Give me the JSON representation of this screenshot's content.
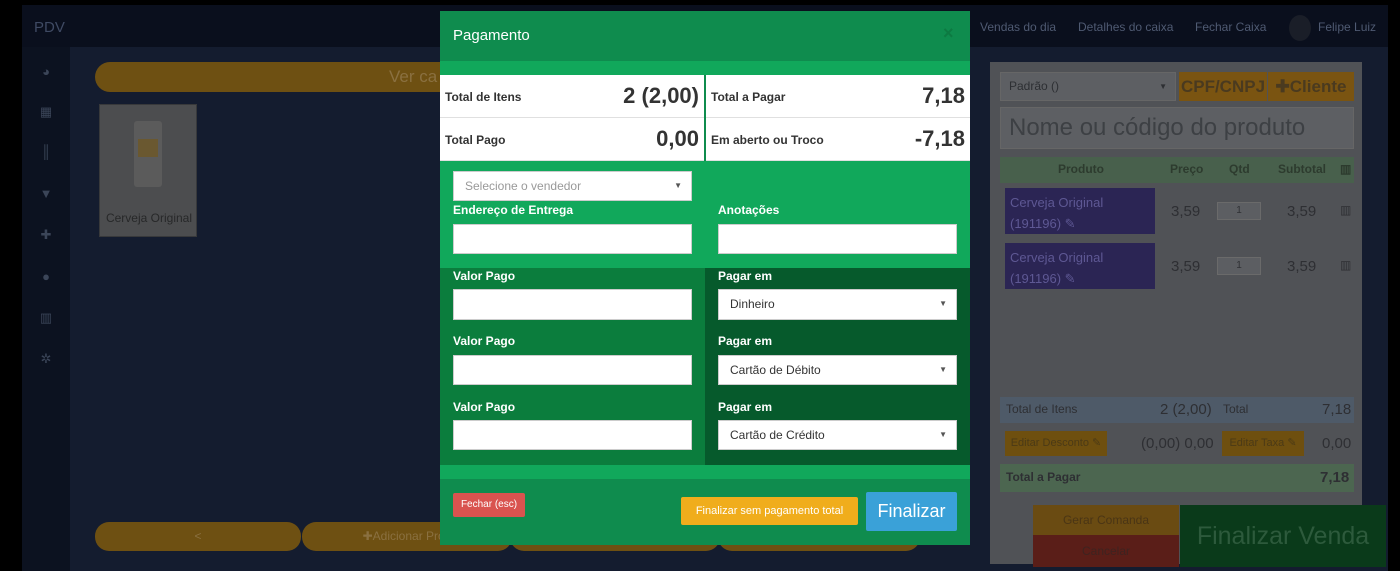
{
  "app": {
    "brand": "PDV",
    "nav": [
      "Vendas do dia",
      "Detalhes do caixa",
      "Fechar Caixa"
    ],
    "user": "Felipe Luiz",
    "sidebar_icons": [
      "dashboard-icon",
      "grid-icon",
      "barcode-icon",
      "cart-icon",
      "plus-icon",
      "users-icon",
      "chart-icon",
      "gears-icon"
    ]
  },
  "catalog": {
    "ver_button": "Ver ca",
    "product": {
      "name": "Cerveja Original"
    },
    "bottom_prev": "<",
    "bottom_add": "✚Adicionar Prod"
  },
  "cart": {
    "price_table": "Padrão ()",
    "cpf_button": "CPF/CNPJ",
    "client_button": "✚Cliente",
    "search_placeholder": "Nome ou código do produto",
    "headers": {
      "produto": "Produto",
      "preco": "Preço",
      "qtd": "Qtd",
      "subtotal": "Subtotal"
    },
    "items": [
      {
        "name": "Cerveja Original",
        "code": "(191196) ✎",
        "price": "3,59",
        "qty": "1",
        "subtotal": "3,59"
      },
      {
        "name": "Cerveja Original",
        "code": "(191196) ✎",
        "price": "3,59",
        "qty": "1",
        "subtotal": "3,59"
      }
    ],
    "total_itens_label": "Total de Itens",
    "total_itens_value": "2 (2,00)",
    "total_label": "Total",
    "total_value": "7,18",
    "edit_discount": "Editar Desconto ✎",
    "discount_value": "(0,00) 0,00",
    "edit_tax": "Editar Taxa ✎",
    "tax_value": "0,00",
    "total_pagar_label": "Total a Pagar",
    "total_pagar_value": "7,18",
    "gerar_comanda": "Gerar Comanda",
    "cancelar": "Cancelar",
    "finalizar_venda": "Finalizar Venda"
  },
  "modal": {
    "title": "Pagamento",
    "close": "×",
    "summary": {
      "total_itens_label": "Total de Itens",
      "total_itens_value": "2 (2,00)",
      "total_pagar_label": "Total a Pagar",
      "total_pagar_value": "7,18",
      "total_pago_label": "Total Pago",
      "total_pago_value": "0,00",
      "aberto_label": "Em aberto ou Troco",
      "aberto_value": "-7,18"
    },
    "vendedor_placeholder": "Selecione o vendedor",
    "endereco_label": "Endereço de Entrega",
    "anotacoes_label": "Anotações",
    "payments": [
      {
        "valor_label": "Valor Pago",
        "pagar_label": "Pagar em",
        "method": "Dinheiro"
      },
      {
        "valor_label": "Valor Pago",
        "pagar_label": "Pagar em",
        "method": "Cartão de Débito"
      },
      {
        "valor_label": "Valor Pago",
        "pagar_label": "Pagar em",
        "method": "Cartão de Crédito"
      }
    ],
    "fechar": "Fechar (esc)",
    "finalizar_sem": "Finalizar sem pagamento total",
    "finalizar": "Finalizar"
  }
}
